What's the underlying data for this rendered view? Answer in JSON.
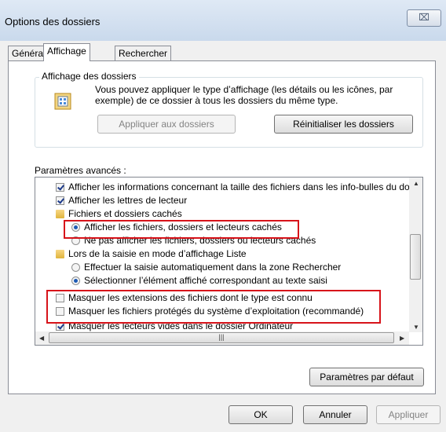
{
  "window": {
    "title": "Options des dossiers",
    "close_glyph": "⌧"
  },
  "tabs": [
    {
      "label": "Général"
    },
    {
      "label": "Affichage"
    },
    {
      "label": "Rechercher"
    }
  ],
  "folder_views": {
    "title": "Affichage des dossiers",
    "description": "Vous pouvez appliquer le type d’affichage (les détails ou les icônes, par exemple) de ce dossier à tous les dossiers du même type.",
    "apply_button": "Appliquer aux dossiers",
    "reset_button": "Réinitialiser les dossiers"
  },
  "advanced": {
    "label": "Paramètres avancés :",
    "items": [
      {
        "kind": "checkbox",
        "checked": true,
        "label": "Afficher les informations concernant la taille des fichiers dans les info-bulles du do"
      },
      {
        "kind": "checkbox",
        "checked": true,
        "label": "Afficher les lettres de lecteur"
      },
      {
        "kind": "folder",
        "label": "Fichiers et dossiers cachés"
      },
      {
        "kind": "radio",
        "checked": true,
        "label": "Afficher les fichiers, dossiers et lecteurs cachés"
      },
      {
        "kind": "radio",
        "checked": false,
        "label": "Ne pas afficher les fichiers, dossiers ou lecteurs cachés"
      },
      {
        "kind": "folder",
        "label": "Lors de la saisie en mode d’affichage Liste"
      },
      {
        "kind": "radio",
        "checked": false,
        "label": "Effectuer la saisie automatiquement dans la zone Rechercher"
      },
      {
        "kind": "radio",
        "checked": true,
        "label": "Sélectionner l’élément affiché correspondant au texte saisi"
      },
      {
        "kind": "checkbox",
        "checked": false,
        "label": "Masquer les extensions des fichiers dont le type est connu"
      },
      {
        "kind": "checkbox",
        "checked": false,
        "label": "Masquer les fichiers protégés du système d’exploitation (recommandé)"
      },
      {
        "kind": "checkbox",
        "checked": true,
        "label": "Masquer les lecteurs vides dans le dossier Ordinateur"
      }
    ]
  },
  "buttons": {
    "defaults": "Paramètres par défaut",
    "ok": "OK",
    "cancel": "Annuler",
    "apply": "Appliquer"
  },
  "highlight_color": "#d7131a"
}
